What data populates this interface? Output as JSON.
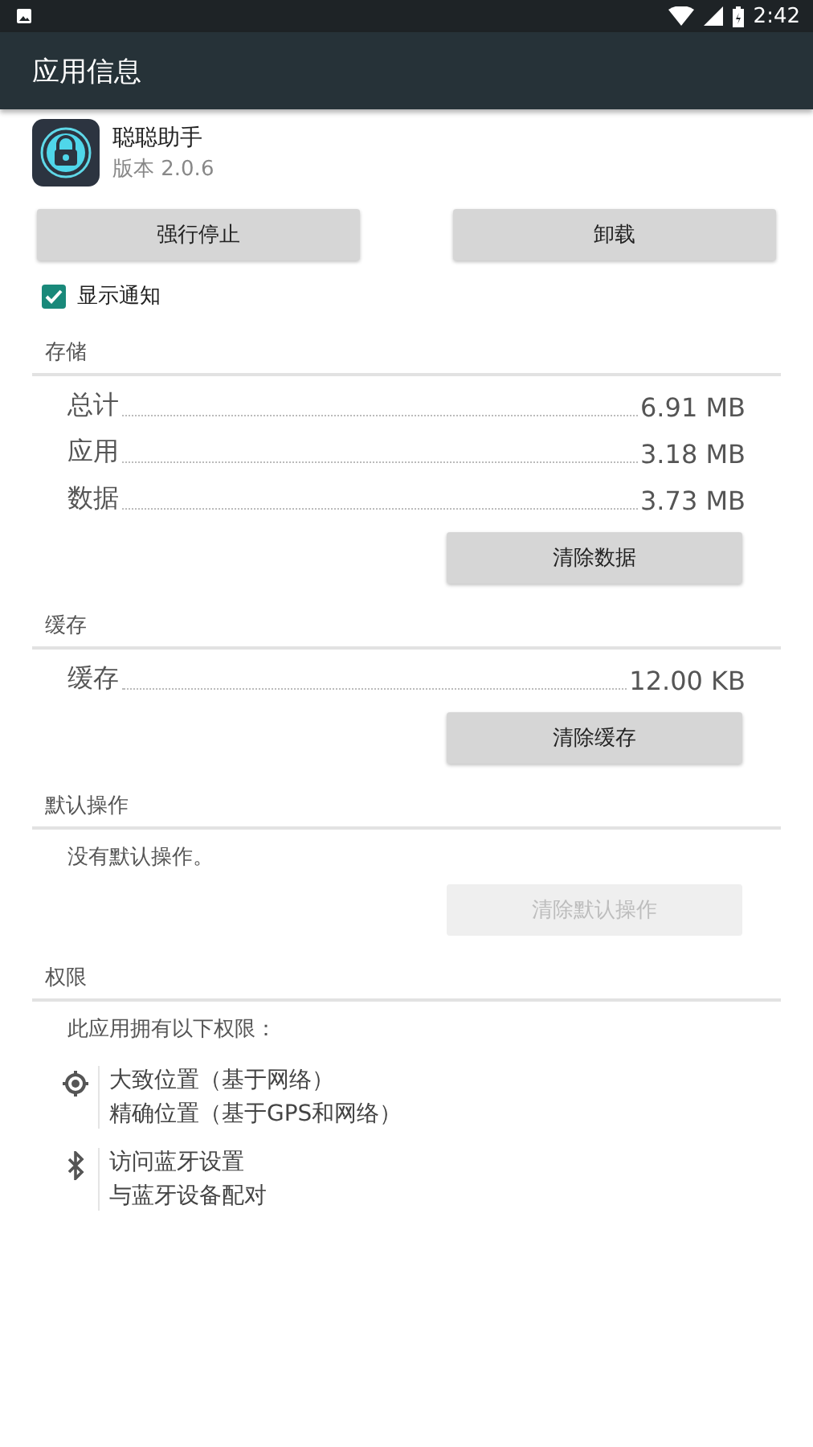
{
  "status_bar": {
    "time": "2:42"
  },
  "app_bar": {
    "title": "应用信息"
  },
  "app": {
    "name": "聪聪助手",
    "version": "版本 2.0.6"
  },
  "actions": [
    {
      "label": "强行停止",
      "disabled": false
    },
    {
      "label": "卸载",
      "disabled": false
    }
  ],
  "notifications": {
    "label": "显示通知",
    "checked": true
  },
  "sections": [
    {
      "title": "存储",
      "rows": [
        {
          "label": "总计",
          "value": "6.91 MB"
        },
        {
          "label": "应用",
          "value": "3.18 MB"
        },
        {
          "label": "数据",
          "value": "3.73 MB"
        }
      ],
      "button": {
        "label": "清除数据",
        "disabled": false
      }
    },
    {
      "title": "缓存",
      "rows": [
        {
          "label": "缓存",
          "value": "12.00 KB"
        }
      ],
      "button": {
        "label": "清除缓存",
        "disabled": false
      }
    },
    {
      "title": "默认操作",
      "note": "没有默认操作。",
      "button": {
        "label": "清除默认操作",
        "disabled": true
      }
    },
    {
      "title": "权限",
      "note": "此应用拥有以下权限：",
      "permissions": [
        {
          "kind": "location",
          "lines": [
            "大致位置（基于网络）",
            "精确位置（基于GPS和网络）"
          ]
        },
        {
          "kind": "bluetooth",
          "lines": [
            "访问蓝牙设置",
            "与蓝牙设备配对"
          ]
        }
      ]
    }
  ]
}
